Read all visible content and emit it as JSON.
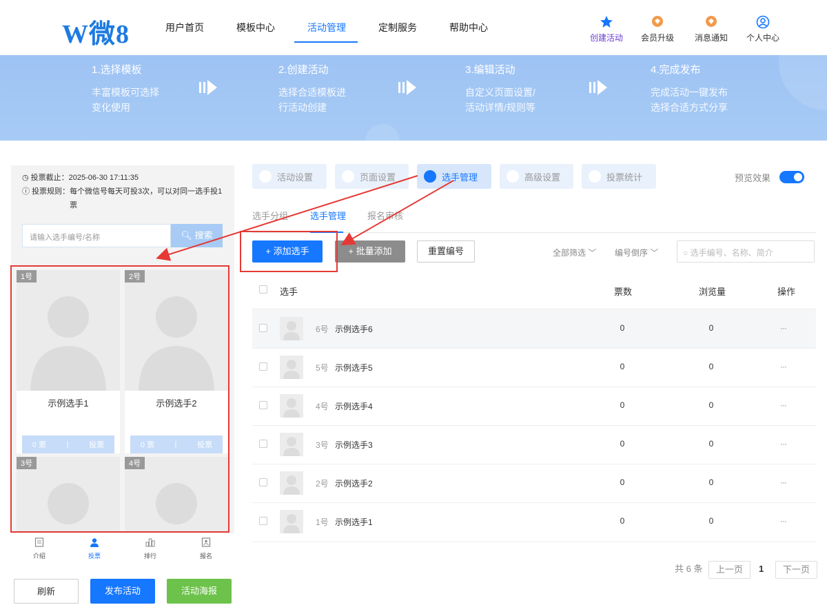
{
  "header": {
    "logo": "W微8",
    "nav": [
      "用户首页",
      "模板中心",
      "活动管理",
      "定制服务",
      "帮助中心"
    ],
    "nav_active": "活动管理",
    "icons": [
      {
        "label": "创建活动",
        "icon": "star-icon"
      },
      {
        "label": "会员升级",
        "icon": "upgrade-icon"
      },
      {
        "label": "消息通知",
        "icon": "bell-icon"
      },
      {
        "label": "个人中心",
        "icon": "user-icon"
      }
    ]
  },
  "banner": {
    "steps": [
      {
        "title": "1.选择模板",
        "desc1": "丰富模板可选择",
        "desc2": "变化使用"
      },
      {
        "title": "2.创建活动",
        "desc1": "选择合适模板进",
        "desc2": "行活动创建"
      },
      {
        "title": "3.编辑活动",
        "desc1": "自定义页面设置/",
        "desc2": "活动详情/规则等"
      },
      {
        "title": "4.完成发布",
        "desc1": "完成活动一键发布",
        "desc2": "选择合适方式分享"
      }
    ]
  },
  "preview": {
    "deadline_label": "投票截止：",
    "deadline": "2025-06-30 17:11:35",
    "rule_label": "投票规则：",
    "rule": "每个微信号每天可投3次，可以对同一选手投1票",
    "search_placeholder": "请输入选手编号/名称",
    "search_btn": "搜索",
    "cards": [
      {
        "tag": "1号",
        "name": "示例选手1",
        "votes": "0 票",
        "vote_btn": "投票"
      },
      {
        "tag": "2号",
        "name": "示例选手2",
        "votes": "0 票",
        "vote_btn": "投票"
      },
      {
        "tag": "3号"
      },
      {
        "tag": "4号"
      }
    ],
    "bottom_nav": [
      "介绍",
      "投票",
      "排行",
      "报名"
    ],
    "buttons": {
      "refresh": "刷新",
      "publish": "发布活动",
      "poster": "活动海报"
    }
  },
  "tabs": [
    "活动设置",
    "页面设置",
    "选手管理",
    "高级设置",
    "投票统计"
  ],
  "tab_active": "选手管理",
  "preview_effect": "预览效果",
  "subtabs": [
    "选手分组",
    "选手管理",
    "报名审核"
  ],
  "toolbar": {
    "add": "+ 添加选手",
    "batch": "+ 批量添加",
    "renumber": "重置编号",
    "filter_all": "全部筛选",
    "sort": "编号倒序",
    "search_placeholder": "选手编号、名称、简介"
  },
  "table": {
    "headers": [
      "选手",
      "票数",
      "浏览量",
      "操作"
    ],
    "rows": [
      {
        "num": "6号",
        "name": "示例选手6",
        "votes": "0",
        "views": "0"
      },
      {
        "num": "5号",
        "name": "示例选手5",
        "votes": "0",
        "views": "0"
      },
      {
        "num": "4号",
        "name": "示例选手4",
        "votes": "0",
        "views": "0"
      },
      {
        "num": "3号",
        "name": "示例选手3",
        "votes": "0",
        "views": "0"
      },
      {
        "num": "2号",
        "name": "示例选手2",
        "votes": "0",
        "views": "0"
      },
      {
        "num": "1号",
        "name": "示例选手1",
        "votes": "0",
        "views": "0"
      }
    ],
    "more": "···"
  },
  "pagination": {
    "total": "共 6 条",
    "prev": "上一页",
    "page": "1",
    "next": "下一页"
  },
  "colors": {
    "primary": "#1677ff",
    "annotation": "#e53935",
    "green": "#6cc24a"
  }
}
